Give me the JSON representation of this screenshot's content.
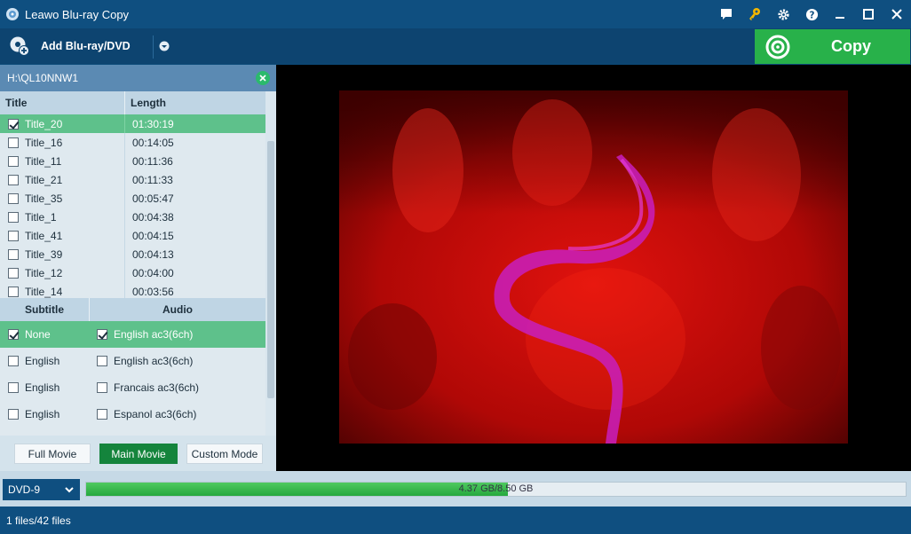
{
  "window": {
    "title": "Leawo Blu-ray Copy"
  },
  "toolbar": {
    "add_label": "Add Blu-ray/DVD",
    "copy_label": "Copy"
  },
  "disc": {
    "path": "H:\\QL10NNW1"
  },
  "title_table": {
    "headers": {
      "title": "Title",
      "length": "Length"
    },
    "rows": [
      {
        "title": "Title_20",
        "length": "01:30:19",
        "checked": true
      },
      {
        "title": "Title_16",
        "length": "00:14:05",
        "checked": false
      },
      {
        "title": "Title_11",
        "length": "00:11:36",
        "checked": false
      },
      {
        "title": "Title_21",
        "length": "00:11:33",
        "checked": false
      },
      {
        "title": "Title_35",
        "length": "00:05:47",
        "checked": false
      },
      {
        "title": "Title_1",
        "length": "00:04:38",
        "checked": false
      },
      {
        "title": "Title_41",
        "length": "00:04:15",
        "checked": false
      },
      {
        "title": "Title_39",
        "length": "00:04:13",
        "checked": false
      },
      {
        "title": "Title_12",
        "length": "00:04:00",
        "checked": false
      },
      {
        "title": "Title_14",
        "length": "00:03:56",
        "checked": false
      }
    ]
  },
  "track_table": {
    "headers": {
      "subtitle": "Subtitle",
      "audio": "Audio"
    },
    "rows": [
      {
        "subtitle": "None",
        "subtitle_checked": true,
        "audio": "English ac3(6ch)",
        "audio_checked": true
      },
      {
        "subtitle": "English",
        "subtitle_checked": false,
        "audio": "English ac3(6ch)",
        "audio_checked": false
      },
      {
        "subtitle": "English",
        "subtitle_checked": false,
        "audio": "Francais ac3(6ch)",
        "audio_checked": false
      },
      {
        "subtitle": "English",
        "subtitle_checked": false,
        "audio": "Espanol ac3(6ch)",
        "audio_checked": false
      }
    ]
  },
  "modes": {
    "full": "Full Movie",
    "main": "Main Movie",
    "custom": "Custom Mode",
    "active": "main"
  },
  "output": {
    "disc_type": "DVD-9",
    "used_gb": 4.37,
    "capacity_gb": 8.5,
    "usage_text": "4.37 GB/8.50 GB"
  },
  "status": {
    "files": "1 files/42 files"
  },
  "colors": {
    "accent_green": "#28b14a",
    "selected_row": "#5ec18b",
    "titlebar": "#0f4f80"
  },
  "icons": [
    "app-logo-icon",
    "feedback-icon",
    "key-icon",
    "gear-icon",
    "help-icon",
    "minimize-icon",
    "maximize-icon",
    "close-icon",
    "add-disc-icon",
    "chevron-down-icon",
    "copy-disc-icon",
    "remove-disc-icon"
  ]
}
